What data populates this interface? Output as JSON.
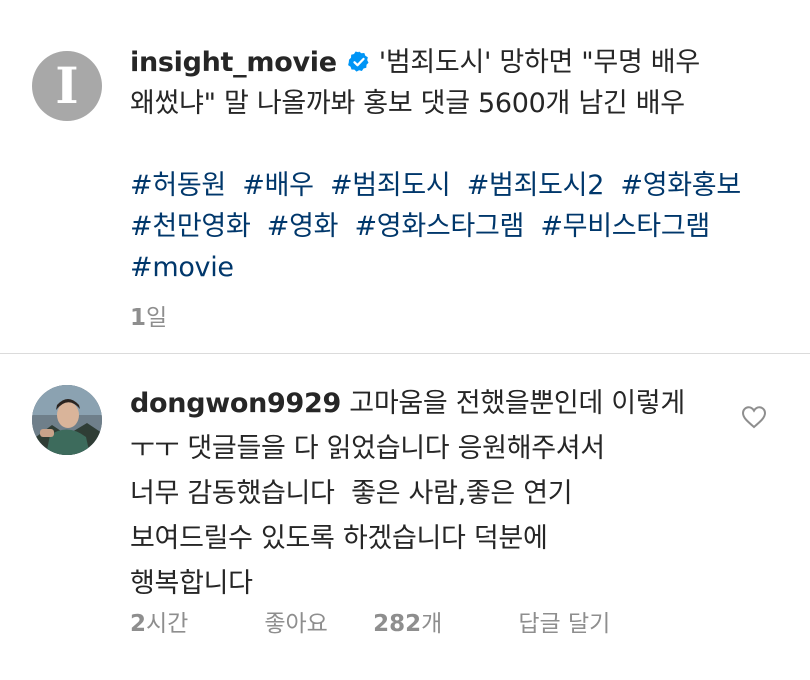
{
  "post": {
    "username": "insight_movie",
    "avatar_letter": "I",
    "caption_line1": "'범죄도시' 망하면 \"무명 배우",
    "caption_line2": "왜썼냐\" 말 나올까봐 홍보 댓글 5600개 남긴 배우",
    "hashtags": [
      "#허동원",
      "#배우",
      "#범죄도시",
      "#범죄도시2",
      "#영화홍보",
      "#천만영화",
      "#영화",
      "#영화스타그램",
      "#무비스타그램",
      "#movie"
    ],
    "time_num": "1",
    "time_unit": "일",
    "verified_icon": "verified-badge-icon",
    "verified_color": "#0095f6"
  },
  "comment": {
    "username": "dongwon9929",
    "lines": [
      "고마움을 전했을뿐인데 이렇게",
      "ㅜㅜ 댓글들을 다 읽었습니다 응원해주셔서",
      "너무 감동했습니다  좋은 사람,좋은 연기",
      "보여드릴수 있도록 하겠습니다 덕분에",
      "행복합니다"
    ],
    "time_num": "2",
    "time_unit": "시간",
    "likes_label": "좋아요",
    "likes_count": "282",
    "likes_unit": "개",
    "reply_label": "답글 달기",
    "like_icon": "heart-icon"
  },
  "colors": {
    "hashtag": "#00376b",
    "meta": "#8e8e8e",
    "text": "#262626"
  }
}
